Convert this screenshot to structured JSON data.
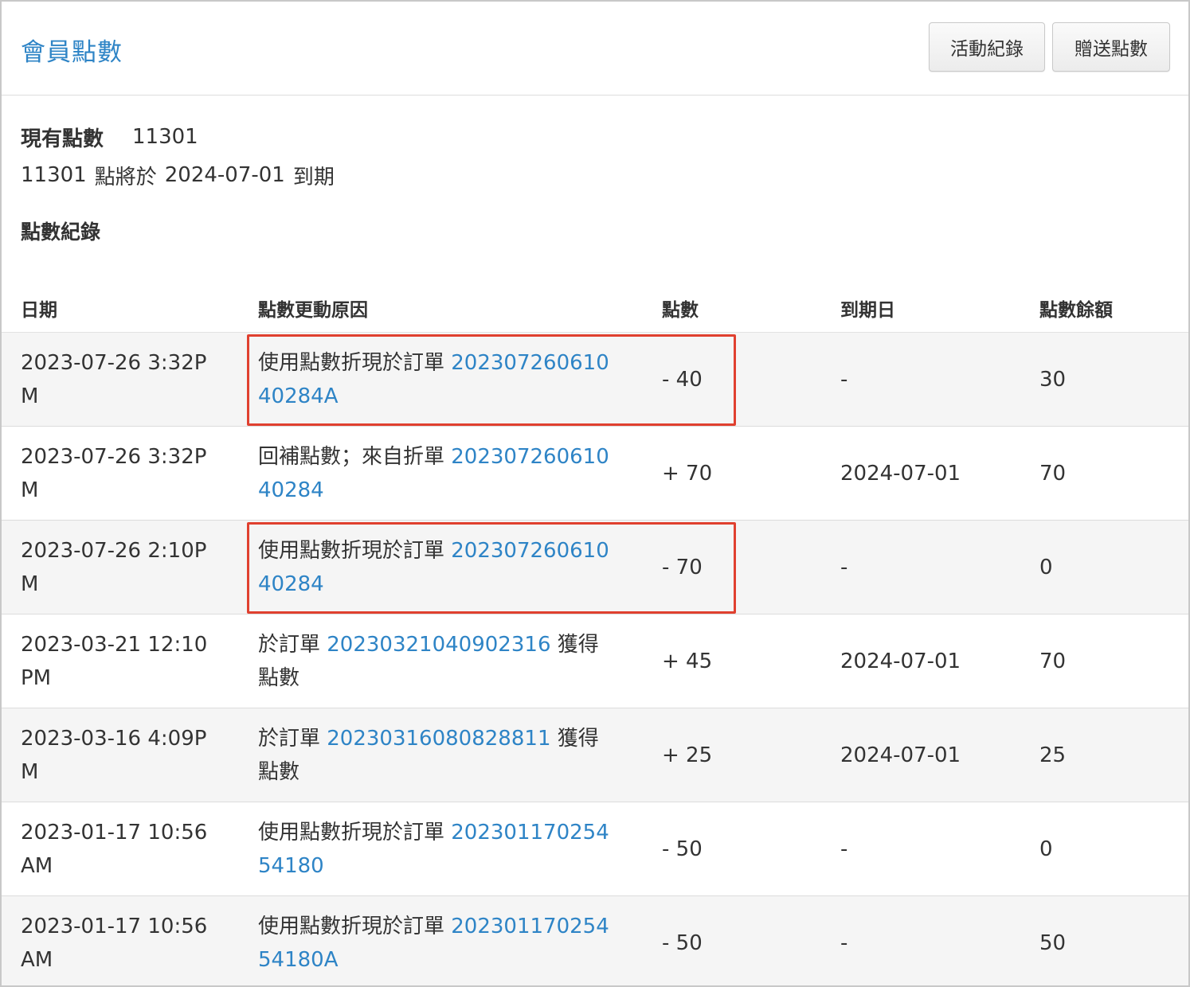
{
  "header": {
    "title": "會員點數",
    "activity_button": "活動紀錄",
    "gift_button": "贈送點數"
  },
  "summary": {
    "current_label": "現有點數",
    "current_value": "11301",
    "expire_points": "11301",
    "expire_text_1": "點將於",
    "expire_date": "2024-07-01",
    "expire_text_2": "到期",
    "record_title": "點數紀錄"
  },
  "table": {
    "headers": [
      "日期",
      "點數更動原因",
      "點數",
      "到期日",
      "點數餘額"
    ],
    "rows": [
      {
        "date": "2023-07-26 3:32PM",
        "reason_pre": "使用點數折現於訂單 ",
        "order": "20230726061040284A",
        "reason_post": "",
        "points": "- 40",
        "expiry": "-",
        "balance": "30",
        "highlight": true
      },
      {
        "date": "2023-07-26 3:32PM",
        "reason_pre": "回補點數；來自折單 ",
        "order": "20230726061040284",
        "reason_post": "",
        "points": "+ 70",
        "expiry": "2024-07-01",
        "balance": "70",
        "highlight": false
      },
      {
        "date": "2023-07-26 2:10PM",
        "reason_pre": "使用點數折現於訂單 ",
        "order": "20230726061040284",
        "reason_post": "",
        "points": "- 70",
        "expiry": "-",
        "balance": "0",
        "highlight": true
      },
      {
        "date": "2023-03-21 12:10 PM",
        "reason_pre": "於訂單 ",
        "order": "20230321040902316",
        "reason_post": " 獲得點數",
        "points": "+ 45",
        "expiry": "2024-07-01",
        "balance": "70",
        "highlight": false
      },
      {
        "date": "2023-03-16 4:09PM",
        "reason_pre": "於訂單 ",
        "order": "20230316080828811",
        "reason_post": " 獲得點數",
        "points": "+ 25",
        "expiry": "2024-07-01",
        "balance": "25",
        "highlight": false
      },
      {
        "date": "2023-01-17 10:56 AM",
        "reason_pre": "使用點數折現於訂單 ",
        "order": "20230117025454180",
        "reason_post": "",
        "points": "- 50",
        "expiry": "-",
        "balance": "0",
        "highlight": false
      },
      {
        "date": "2023-01-17 10:56 AM",
        "reason_pre": "使用點數折現於訂單 ",
        "order": "20230117025454180A",
        "reason_post": "",
        "points": "- 50",
        "expiry": "-",
        "balance": "50",
        "highlight": false
      }
    ]
  },
  "colors": {
    "accent": "#2e84c6",
    "highlight_border": "#e0402f",
    "alt_row": "#f5f5f5"
  }
}
